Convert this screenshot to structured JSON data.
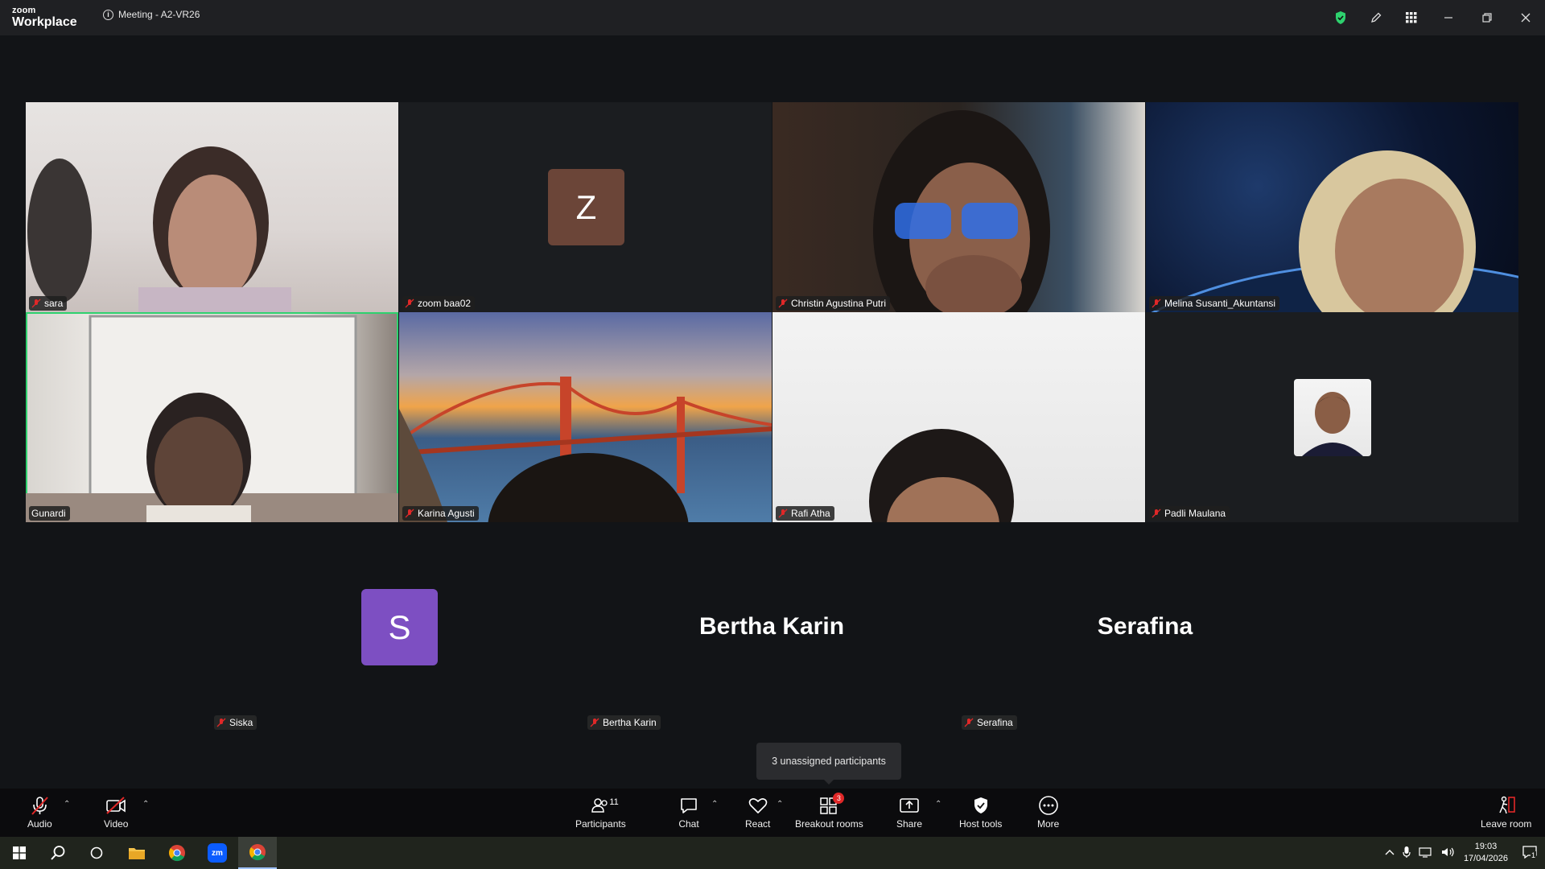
{
  "app": {
    "brand_small": "zoom",
    "brand_big": "Workplace",
    "meeting_title": "Meeting - A2-VR26",
    "info_glyph": "i"
  },
  "tiles": [
    {
      "name": "sara"
    },
    {
      "name": "zoom baa02",
      "avatar_letter": "Z",
      "avatar_color": "#6b4538"
    },
    {
      "name": "Christin Agustina Putri"
    },
    {
      "name": "Melina Susanti_Akuntansi"
    },
    {
      "name": "Gunardi",
      "active_speaker": true
    },
    {
      "name": "Karina Agusti"
    },
    {
      "name": "Rafi Atha"
    },
    {
      "name": "Padli Maulana"
    }
  ],
  "bottom_row": [
    {
      "name": "Siska",
      "avatar_letter": "S",
      "avatar_color": "#7d4fc2"
    },
    {
      "name": "Bertha Karin",
      "display_name": "Bertha Karin"
    },
    {
      "name": "Serafina",
      "display_name": "Serafina"
    }
  ],
  "tooltip": "3 unassigned participants",
  "toolbar": {
    "audio": "Audio",
    "video": "Video",
    "participants": "Participants",
    "participants_count": "11",
    "chat": "Chat",
    "react": "React",
    "breakout": "Breakout rooms",
    "breakout_badge": "3",
    "share": "Share",
    "host_tools": "Host tools",
    "more": "More",
    "leave": "Leave room"
  },
  "taskbar": {
    "time": "19:03",
    "date": "17/04/2026",
    "notifications": "1",
    "zoom_label": "zm"
  },
  "colors": {
    "active_speaker": "#2ed16e",
    "muted": "#e02828",
    "shield": "#2ed16e"
  }
}
